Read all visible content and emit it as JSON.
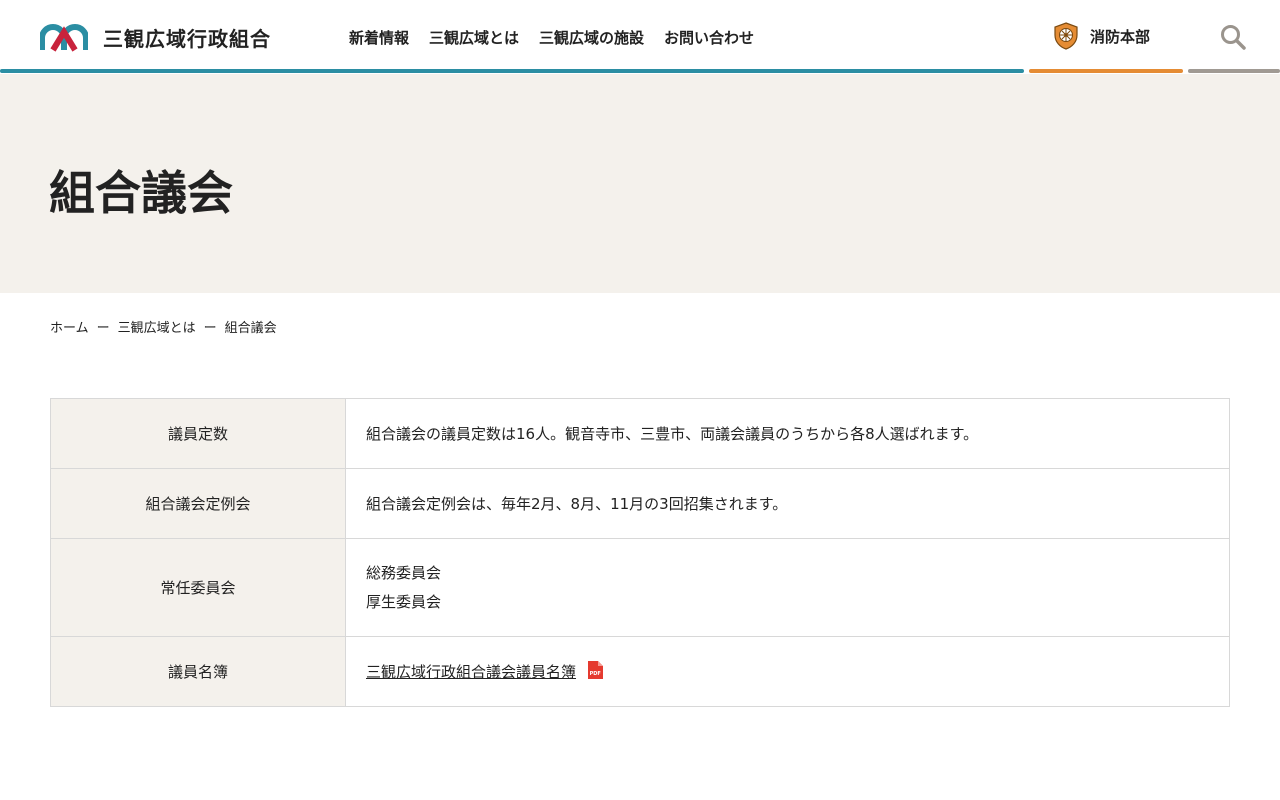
{
  "header": {
    "site_name": "三観広域行政組合",
    "nav": [
      "新着情報",
      "三観広域とは",
      "三観広域の施設",
      "お問い合わせ"
    ],
    "fire_department_label": "消防本部"
  },
  "colors": {
    "teal": "#2b8ea3",
    "orange": "#e58c34",
    "gray": "#a09a93",
    "logo_red": "#c8233c",
    "hero_bg": "#f4f1ec",
    "pdf_red": "#e53a2f"
  },
  "icons": {
    "search": "search-icon",
    "fire_emblem": "fire-emblem-icon",
    "pdf": "pdf-icon",
    "logo": "logo-mark"
  },
  "hero": {
    "title": "組合議会"
  },
  "breadcrumb": {
    "home": "ホーム",
    "separator": "ー",
    "parent": "三観広域とは",
    "current": "組合議会"
  },
  "table": {
    "rows": [
      {
        "label": "議員定数",
        "value": "組合議会の議員定数は16人。観音寺市、三豊市、両議会議員のうちから各8人選ばれます。"
      },
      {
        "label": "組合議会定例会",
        "value": "組合議会定例会は、毎年2月、8月、11月の3回招集されます。"
      },
      {
        "label": "常任委員会",
        "values": [
          "総務委員会",
          "厚生委員会"
        ]
      },
      {
        "label": "議員名簿",
        "link": "三観広域行政組合議会議員名簿",
        "pdf_badge": "PDF"
      }
    ]
  }
}
